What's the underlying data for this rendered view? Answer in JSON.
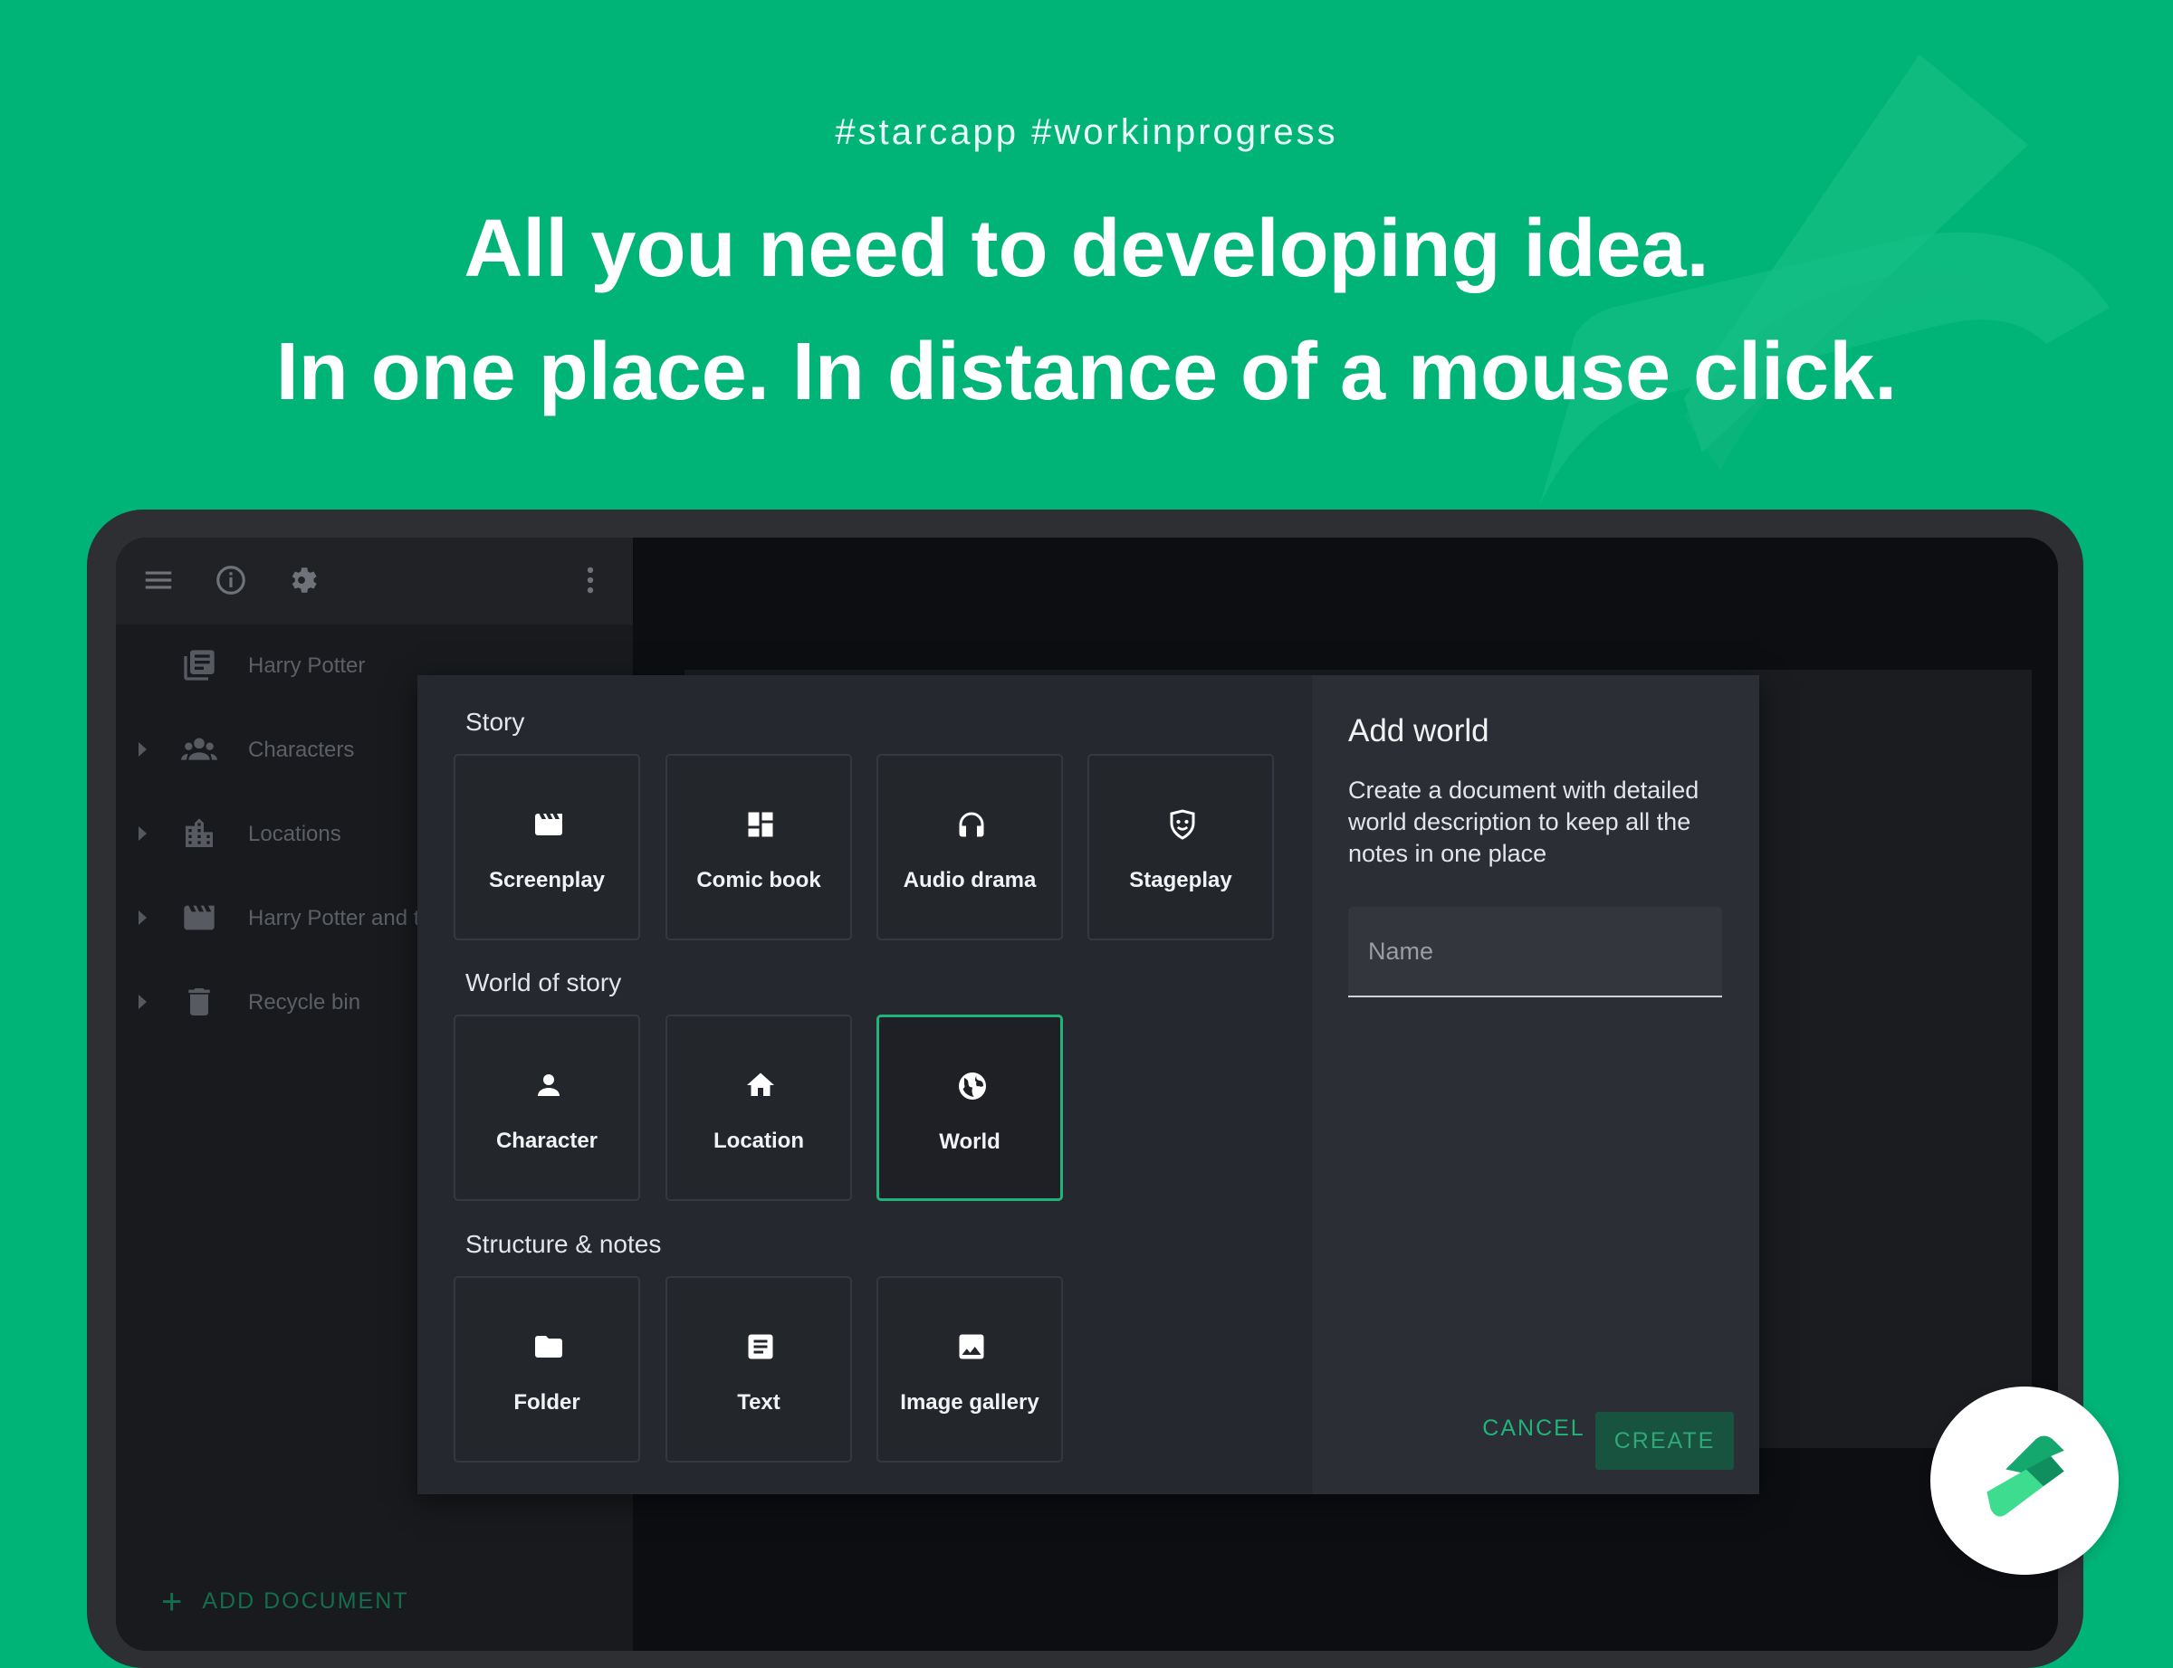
{
  "hero": {
    "tags": "#starcapp  #workinprogress",
    "headline_line1": "All you need to developing idea.",
    "headline_line2": "In one place. In distance of a mouse click."
  },
  "sidebar": {
    "toolbar_icons": [
      "menu-icon",
      "info-icon",
      "settings-icon",
      "more-vertical-icon"
    ],
    "items": [
      {
        "label": "Harry Potter",
        "icon": "project-icon",
        "expandable": false
      },
      {
        "label": "Characters",
        "icon": "people-icon",
        "expandable": true
      },
      {
        "label": "Locations",
        "icon": "city-icon",
        "expandable": true
      },
      {
        "label": "Harry Potter and t",
        "icon": "clapperboard-icon",
        "expandable": true
      },
      {
        "label": "Recycle bin",
        "icon": "trash-icon",
        "expandable": true
      }
    ],
    "add_document": "ADD DOCUMENT"
  },
  "dialog": {
    "sections": [
      {
        "title": "Story",
        "cards": [
          {
            "label": "Screenplay",
            "icon": "clapperboard-icon"
          },
          {
            "label": "Comic book",
            "icon": "comic-book-icon"
          },
          {
            "label": "Audio drama",
            "icon": "headphones-icon"
          },
          {
            "label": "Stageplay",
            "icon": "theater-mask-icon"
          }
        ]
      },
      {
        "title": "World of story",
        "cards": [
          {
            "label": "Character",
            "icon": "person-icon"
          },
          {
            "label": "Location",
            "icon": "home-icon"
          },
          {
            "label": "World",
            "icon": "globe-icon",
            "selected": true
          }
        ]
      },
      {
        "title": "Structure & notes",
        "cards": [
          {
            "label": "Folder",
            "icon": "folder-icon"
          },
          {
            "label": "Text",
            "icon": "document-text-icon"
          },
          {
            "label": "Image gallery",
            "icon": "image-icon"
          }
        ]
      }
    ],
    "details": {
      "title": "Add world",
      "description": "Create a document with detailed world description to keep all the notes in one place",
      "name_placeholder": "Name",
      "name_value": "",
      "cancel_label": "CANCEL",
      "create_label": "CREATE"
    }
  },
  "colors": {
    "brand_green": "#00B377",
    "accent": "#1FB47A",
    "dialog_bg": "#25282E"
  }
}
